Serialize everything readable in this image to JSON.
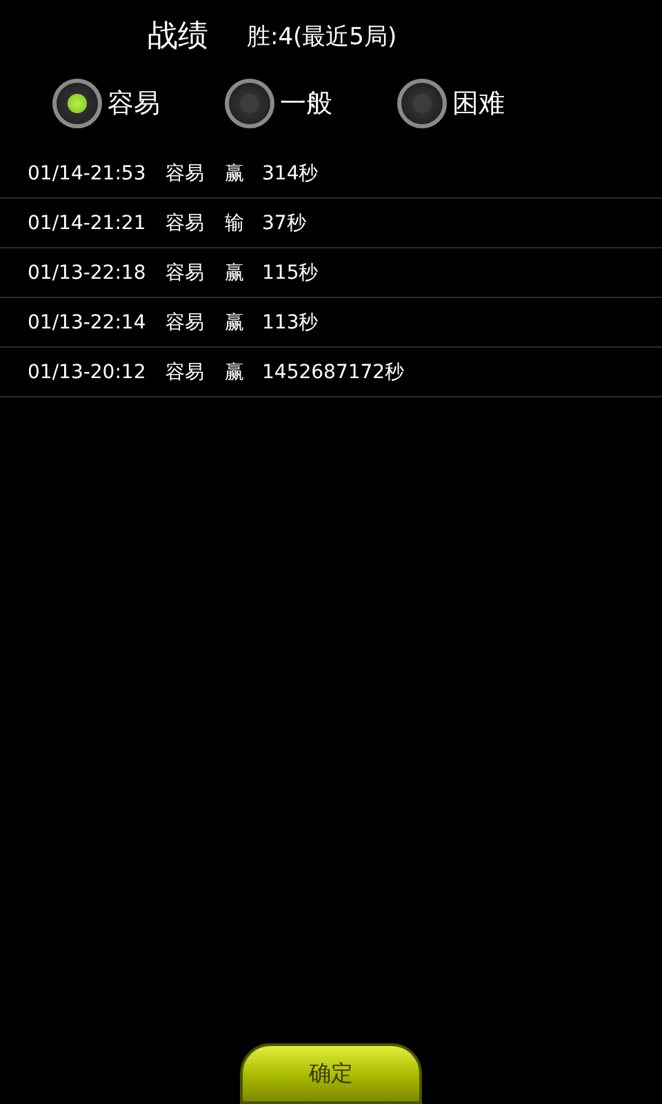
{
  "header": {
    "title": "战绩",
    "summary": "胜:4(最近5局)"
  },
  "difficulties": [
    {
      "label": "容易",
      "selected": true
    },
    {
      "label": "一般",
      "selected": false
    },
    {
      "label": "困难",
      "selected": false
    }
  ],
  "records": [
    {
      "time": "01/14-21:53",
      "level": "容易",
      "result": "赢",
      "duration": "314秒"
    },
    {
      "time": "01/14-21:21",
      "level": "容易",
      "result": "输",
      "duration": "37秒"
    },
    {
      "time": "01/13-22:18",
      "level": "容易",
      "result": "赢",
      "duration": "115秒"
    },
    {
      "time": "01/13-22:14",
      "level": "容易",
      "result": "赢",
      "duration": "113秒"
    },
    {
      "time": "01/13-20:12",
      "level": "容易",
      "result": "赢",
      "duration": "1452687172秒"
    }
  ],
  "confirm_button": "确定"
}
